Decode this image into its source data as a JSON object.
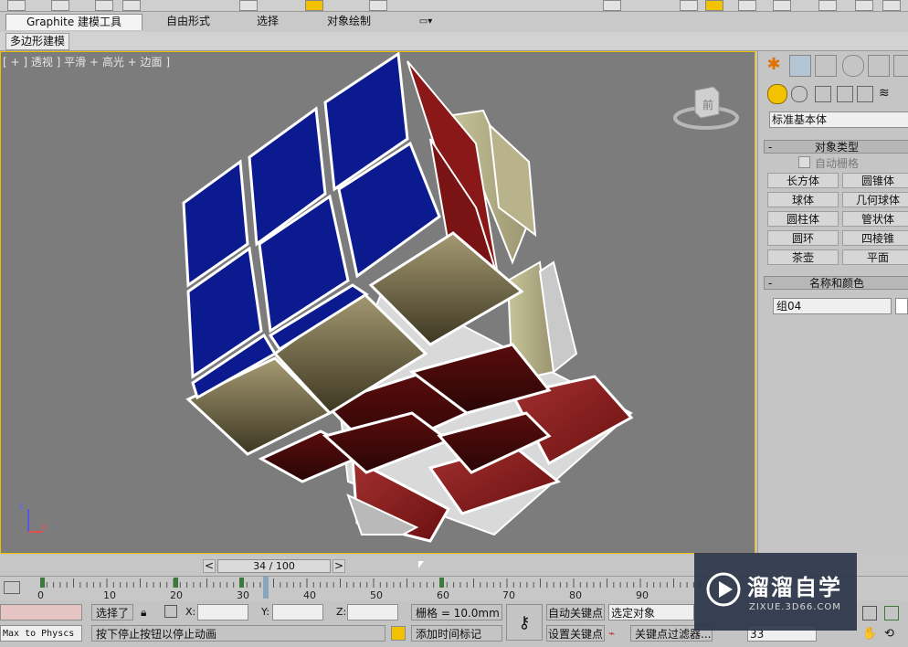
{
  "ribbon": {
    "tabs": [
      "Graphite 建模工具",
      "自由形式",
      "选择",
      "对象绘制"
    ],
    "subtab": "多边形建模"
  },
  "viewport": {
    "label": "[ + ] 透视 ] 平滑 + 高光 + 边面 ]",
    "viewcube_label": "前",
    "axes": {
      "x": "x",
      "z": "z"
    }
  },
  "command_panel": {
    "dropdown_value": "标准基本体",
    "object_type": {
      "title": "对象类型",
      "autogrid_label": "自动栅格",
      "buttons": [
        "长方体",
        "圆锥体",
        "球体",
        "几何球体",
        "圆柱体",
        "管状体",
        "圆环",
        "四棱锥",
        "茶壶",
        "平面"
      ]
    },
    "name_color": {
      "title": "名称和颜色",
      "name_value": "组04"
    }
  },
  "timeline": {
    "frame_display": "34 / 100",
    "prev": "<",
    "next": ">",
    "current_frame": 34,
    "total_frames": 100,
    "ticks": [
      "0",
      "10",
      "20",
      "30",
      "40",
      "50",
      "60",
      "70",
      "80",
      "90"
    ]
  },
  "status_bar": {
    "maxscript_text": "Max to Physcs (",
    "selected_text": "选择了",
    "x_label": "X:",
    "y_label": "Y:",
    "z_label": "Z:",
    "grid_text": "栅格 = 10.0mm",
    "prompt_text": "按下停止按钮以停止动画",
    "add_time_tag": "添加时间标记",
    "auto_key": "自动关键点",
    "set_key": "设置关键点",
    "selection_value": "选定对象",
    "key_filters": "关键点过滤器...",
    "frame_value": "33"
  },
  "watermark": {
    "brand": "溜溜自学",
    "url": "ZIXUE.3D66.COM"
  },
  "colors": {
    "viewport_bg": "#7c7c7c",
    "active_border": "#f0c000",
    "cube_blue": "#0a1a8c",
    "cube_red": "#8a1a1a",
    "cube_tan": "#8e8460"
  }
}
